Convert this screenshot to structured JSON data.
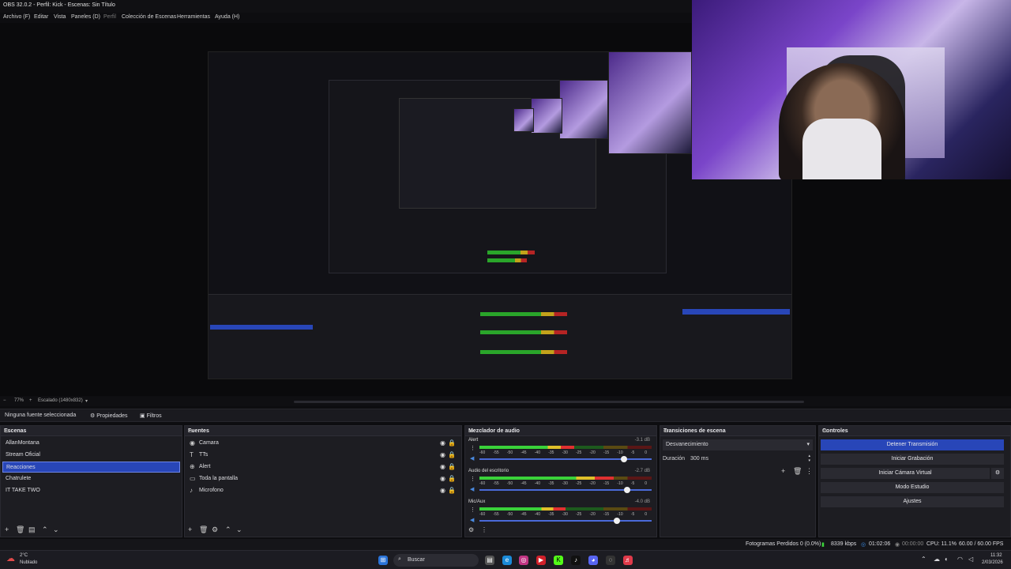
{
  "window_title": "OBS 32.0.2 - Perfil: Kick - Escenas: Sin Título",
  "menu": [
    "Archivo (F)",
    "Editar",
    "Vista",
    "Paneles (D)",
    "Perfil",
    "Colección de Escenas",
    "Herramientas",
    "Ayuda (H)"
  ],
  "preview_bar": {
    "zoom": "77%",
    "scale": "Escalado (1480x832)"
  },
  "source_bar": {
    "none_selected": "Ninguna fuente seleccionada",
    "properties": "Propiedades",
    "filters": "Filtros"
  },
  "scenes": {
    "title": "Escenas",
    "items": [
      "AllanMontana",
      "Stream Oficial",
      "Reacciones",
      "Chatrulete",
      "IT TAKE TWO"
    ],
    "selected": "Reacciones"
  },
  "sources": {
    "title": "Fuentes",
    "items": [
      {
        "label": "Camara",
        "icon": "camera-icon"
      },
      {
        "label": "TTs",
        "icon": "text-icon"
      },
      {
        "label": "Alert",
        "icon": "browser-icon"
      },
      {
        "label": "Toda la pantalla",
        "icon": "monitor-icon"
      },
      {
        "label": "Microfono",
        "icon": "mic-icon"
      }
    ]
  },
  "mixer": {
    "title": "Mezclador de audio",
    "channels": [
      {
        "name": "Alert",
        "db": "-3.1 dB",
        "level": 0.55,
        "volume": 0.84
      },
      {
        "name": "Audio del escritorio",
        "db": "-2.7 dB",
        "level": 0.78,
        "volume": 0.86
      },
      {
        "name": "Mic/Aux",
        "db": "-4.0 dB",
        "level": 0.5,
        "volume": 0.8
      }
    ],
    "ticks": [
      "-60",
      "-55",
      "-50",
      "-45",
      "-40",
      "-35",
      "-30",
      "-25",
      "-20",
      "-15",
      "-10",
      "-5",
      "0"
    ]
  },
  "transitions": {
    "title": "Transiciones de escena",
    "selected": "Desvanecimiento",
    "duration_label": "Duración",
    "duration_value": "300 ms"
  },
  "controls": {
    "title": "Controles",
    "buttons": [
      "Detener Transmisión",
      "Iniciar Grabación",
      "Iniciar Cámara Virtual",
      "Modo Estudio",
      "Ajustes"
    ]
  },
  "status": {
    "dropped": "Fotogramas Perdidos 0 (0.0%)",
    "bitrate": "8339 kbps",
    "stream_time": "01:02:06",
    "rec_time": "00:00:00",
    "cpu": "CPU: 11.1%",
    "fps": "60.00 / 60.00 FPS"
  },
  "taskbar": {
    "weather_temp": "2°C",
    "weather_desc": "Nublado",
    "search": "Buscar",
    "time": "11:32",
    "date": "2/03/2026"
  },
  "colors": {
    "accent": "#2846b8",
    "meter_green": "#3ad23a",
    "meter_yellow": "#e0c02a",
    "meter_red": "#e03030"
  }
}
